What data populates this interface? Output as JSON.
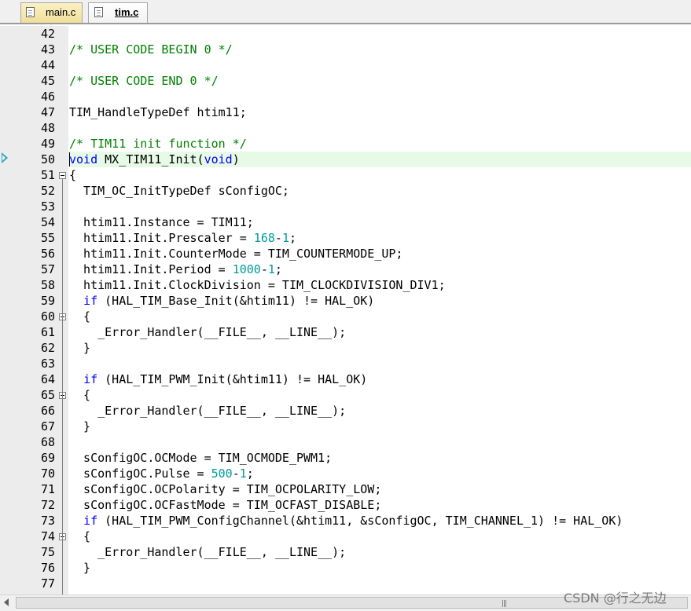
{
  "tabs": [
    {
      "label": "main.c",
      "active": false
    },
    {
      "label": "tim.c",
      "active": true
    }
  ],
  "editor": {
    "current_line": 50,
    "lines": [
      {
        "num": "42",
        "code": [],
        "fold": false
      },
      {
        "num": "43",
        "code": [
          {
            "t": "/* USER CODE BEGIN 0 */",
            "s": "c"
          }
        ],
        "fold": false
      },
      {
        "num": "44",
        "code": [],
        "fold": false
      },
      {
        "num": "45",
        "code": [
          {
            "t": "/* USER CODE END 0 */",
            "s": "c"
          }
        ],
        "fold": false
      },
      {
        "num": "46",
        "code": [],
        "fold": false
      },
      {
        "num": "47",
        "code": [
          {
            "t": "TIM_HandleTypeDef htim11;",
            "s": ""
          }
        ],
        "fold": false
      },
      {
        "num": "48",
        "code": [],
        "fold": false
      },
      {
        "num": "49",
        "code": [
          {
            "t": "/* TIM11 init function */",
            "s": "c"
          }
        ],
        "fold": false
      },
      {
        "num": "50",
        "code": [
          {
            "t": "void",
            "s": "k"
          },
          {
            "t": " MX_TIM11_Init(",
            "s": ""
          },
          {
            "t": "void",
            "s": "k"
          },
          {
            "t": ")",
            "s": ""
          }
        ],
        "fold": false
      },
      {
        "num": "51",
        "code": [
          {
            "t": "{",
            "s": ""
          }
        ],
        "fold": true
      },
      {
        "num": "52",
        "code": [
          {
            "t": "  TIM_OC_InitTypeDef sConfigOC;",
            "s": ""
          }
        ],
        "fold": false
      },
      {
        "num": "53",
        "code": [],
        "fold": false
      },
      {
        "num": "54",
        "code": [
          {
            "t": "  htim11.Instance = TIM11;",
            "s": ""
          }
        ],
        "fold": false
      },
      {
        "num": "55",
        "code": [
          {
            "t": "  htim11.Init.Prescaler = ",
            "s": ""
          },
          {
            "t": "168",
            "s": "n"
          },
          {
            "t": "-",
            "s": ""
          },
          {
            "t": "1",
            "s": "n"
          },
          {
            "t": ";",
            "s": ""
          }
        ],
        "fold": false
      },
      {
        "num": "56",
        "code": [
          {
            "t": "  htim11.Init.CounterMode = TIM_COUNTERMODE_UP;",
            "s": ""
          }
        ],
        "fold": false
      },
      {
        "num": "57",
        "code": [
          {
            "t": "  htim11.Init.Period = ",
            "s": ""
          },
          {
            "t": "1000",
            "s": "n"
          },
          {
            "t": "-",
            "s": ""
          },
          {
            "t": "1",
            "s": "n"
          },
          {
            "t": ";",
            "s": ""
          }
        ],
        "fold": false
      },
      {
        "num": "58",
        "code": [
          {
            "t": "  htim11.Init.ClockDivision = TIM_CLOCKDIVISION_DIV1;",
            "s": ""
          }
        ],
        "fold": false
      },
      {
        "num": "59",
        "code": [
          {
            "t": "  ",
            "s": ""
          },
          {
            "t": "if",
            "s": "k"
          },
          {
            "t": " (HAL_TIM_Base_Init(&htim11) != HAL_OK)",
            "s": ""
          }
        ],
        "fold": false
      },
      {
        "num": "60",
        "code": [
          {
            "t": "  {",
            "s": ""
          }
        ],
        "fold": true
      },
      {
        "num": "61",
        "code": [
          {
            "t": "    _Error_Handler(__FILE__, __LINE__);",
            "s": ""
          }
        ],
        "fold": false
      },
      {
        "num": "62",
        "code": [
          {
            "t": "  }",
            "s": ""
          }
        ],
        "fold": false
      },
      {
        "num": "63",
        "code": [],
        "fold": false
      },
      {
        "num": "64",
        "code": [
          {
            "t": "  ",
            "s": ""
          },
          {
            "t": "if",
            "s": "k"
          },
          {
            "t": " (HAL_TIM_PWM_Init(&htim11) != HAL_OK)",
            "s": ""
          }
        ],
        "fold": false
      },
      {
        "num": "65",
        "code": [
          {
            "t": "  {",
            "s": ""
          }
        ],
        "fold": true
      },
      {
        "num": "66",
        "code": [
          {
            "t": "    _Error_Handler(__FILE__, __LINE__);",
            "s": ""
          }
        ],
        "fold": false
      },
      {
        "num": "67",
        "code": [
          {
            "t": "  }",
            "s": ""
          }
        ],
        "fold": false
      },
      {
        "num": "68",
        "code": [],
        "fold": false
      },
      {
        "num": "69",
        "code": [
          {
            "t": "  sConfigOC.OCMode = TIM_OCMODE_PWM1;",
            "s": ""
          }
        ],
        "fold": false
      },
      {
        "num": "70",
        "code": [
          {
            "t": "  sConfigOC.Pulse = ",
            "s": ""
          },
          {
            "t": "500",
            "s": "n"
          },
          {
            "t": "-",
            "s": ""
          },
          {
            "t": "1",
            "s": "n"
          },
          {
            "t": ";",
            "s": ""
          }
        ],
        "fold": false
      },
      {
        "num": "71",
        "code": [
          {
            "t": "  sConfigOC.OCPolarity = TIM_OCPOLARITY_LOW;",
            "s": ""
          }
        ],
        "fold": false
      },
      {
        "num": "72",
        "code": [
          {
            "t": "  sConfigOC.OCFastMode = TIM_OCFAST_DISABLE;",
            "s": ""
          }
        ],
        "fold": false
      },
      {
        "num": "73",
        "code": [
          {
            "t": "  ",
            "s": ""
          },
          {
            "t": "if",
            "s": "k"
          },
          {
            "t": " (HAL_TIM_PWM_ConfigChannel(&htim11, &sConfigOC, TIM_CHANNEL_1) != HAL_OK)",
            "s": ""
          }
        ],
        "fold": false
      },
      {
        "num": "74",
        "code": [
          {
            "t": "  {",
            "s": ""
          }
        ],
        "fold": true
      },
      {
        "num": "75",
        "code": [
          {
            "t": "    _Error_Handler(__FILE__, __LINE__);",
            "s": ""
          }
        ],
        "fold": false
      },
      {
        "num": "76",
        "code": [
          {
            "t": "  }",
            "s": ""
          }
        ],
        "fold": false
      },
      {
        "num": "77",
        "code": [],
        "fold": false
      }
    ]
  },
  "watermark": "CSDN @行之无边"
}
